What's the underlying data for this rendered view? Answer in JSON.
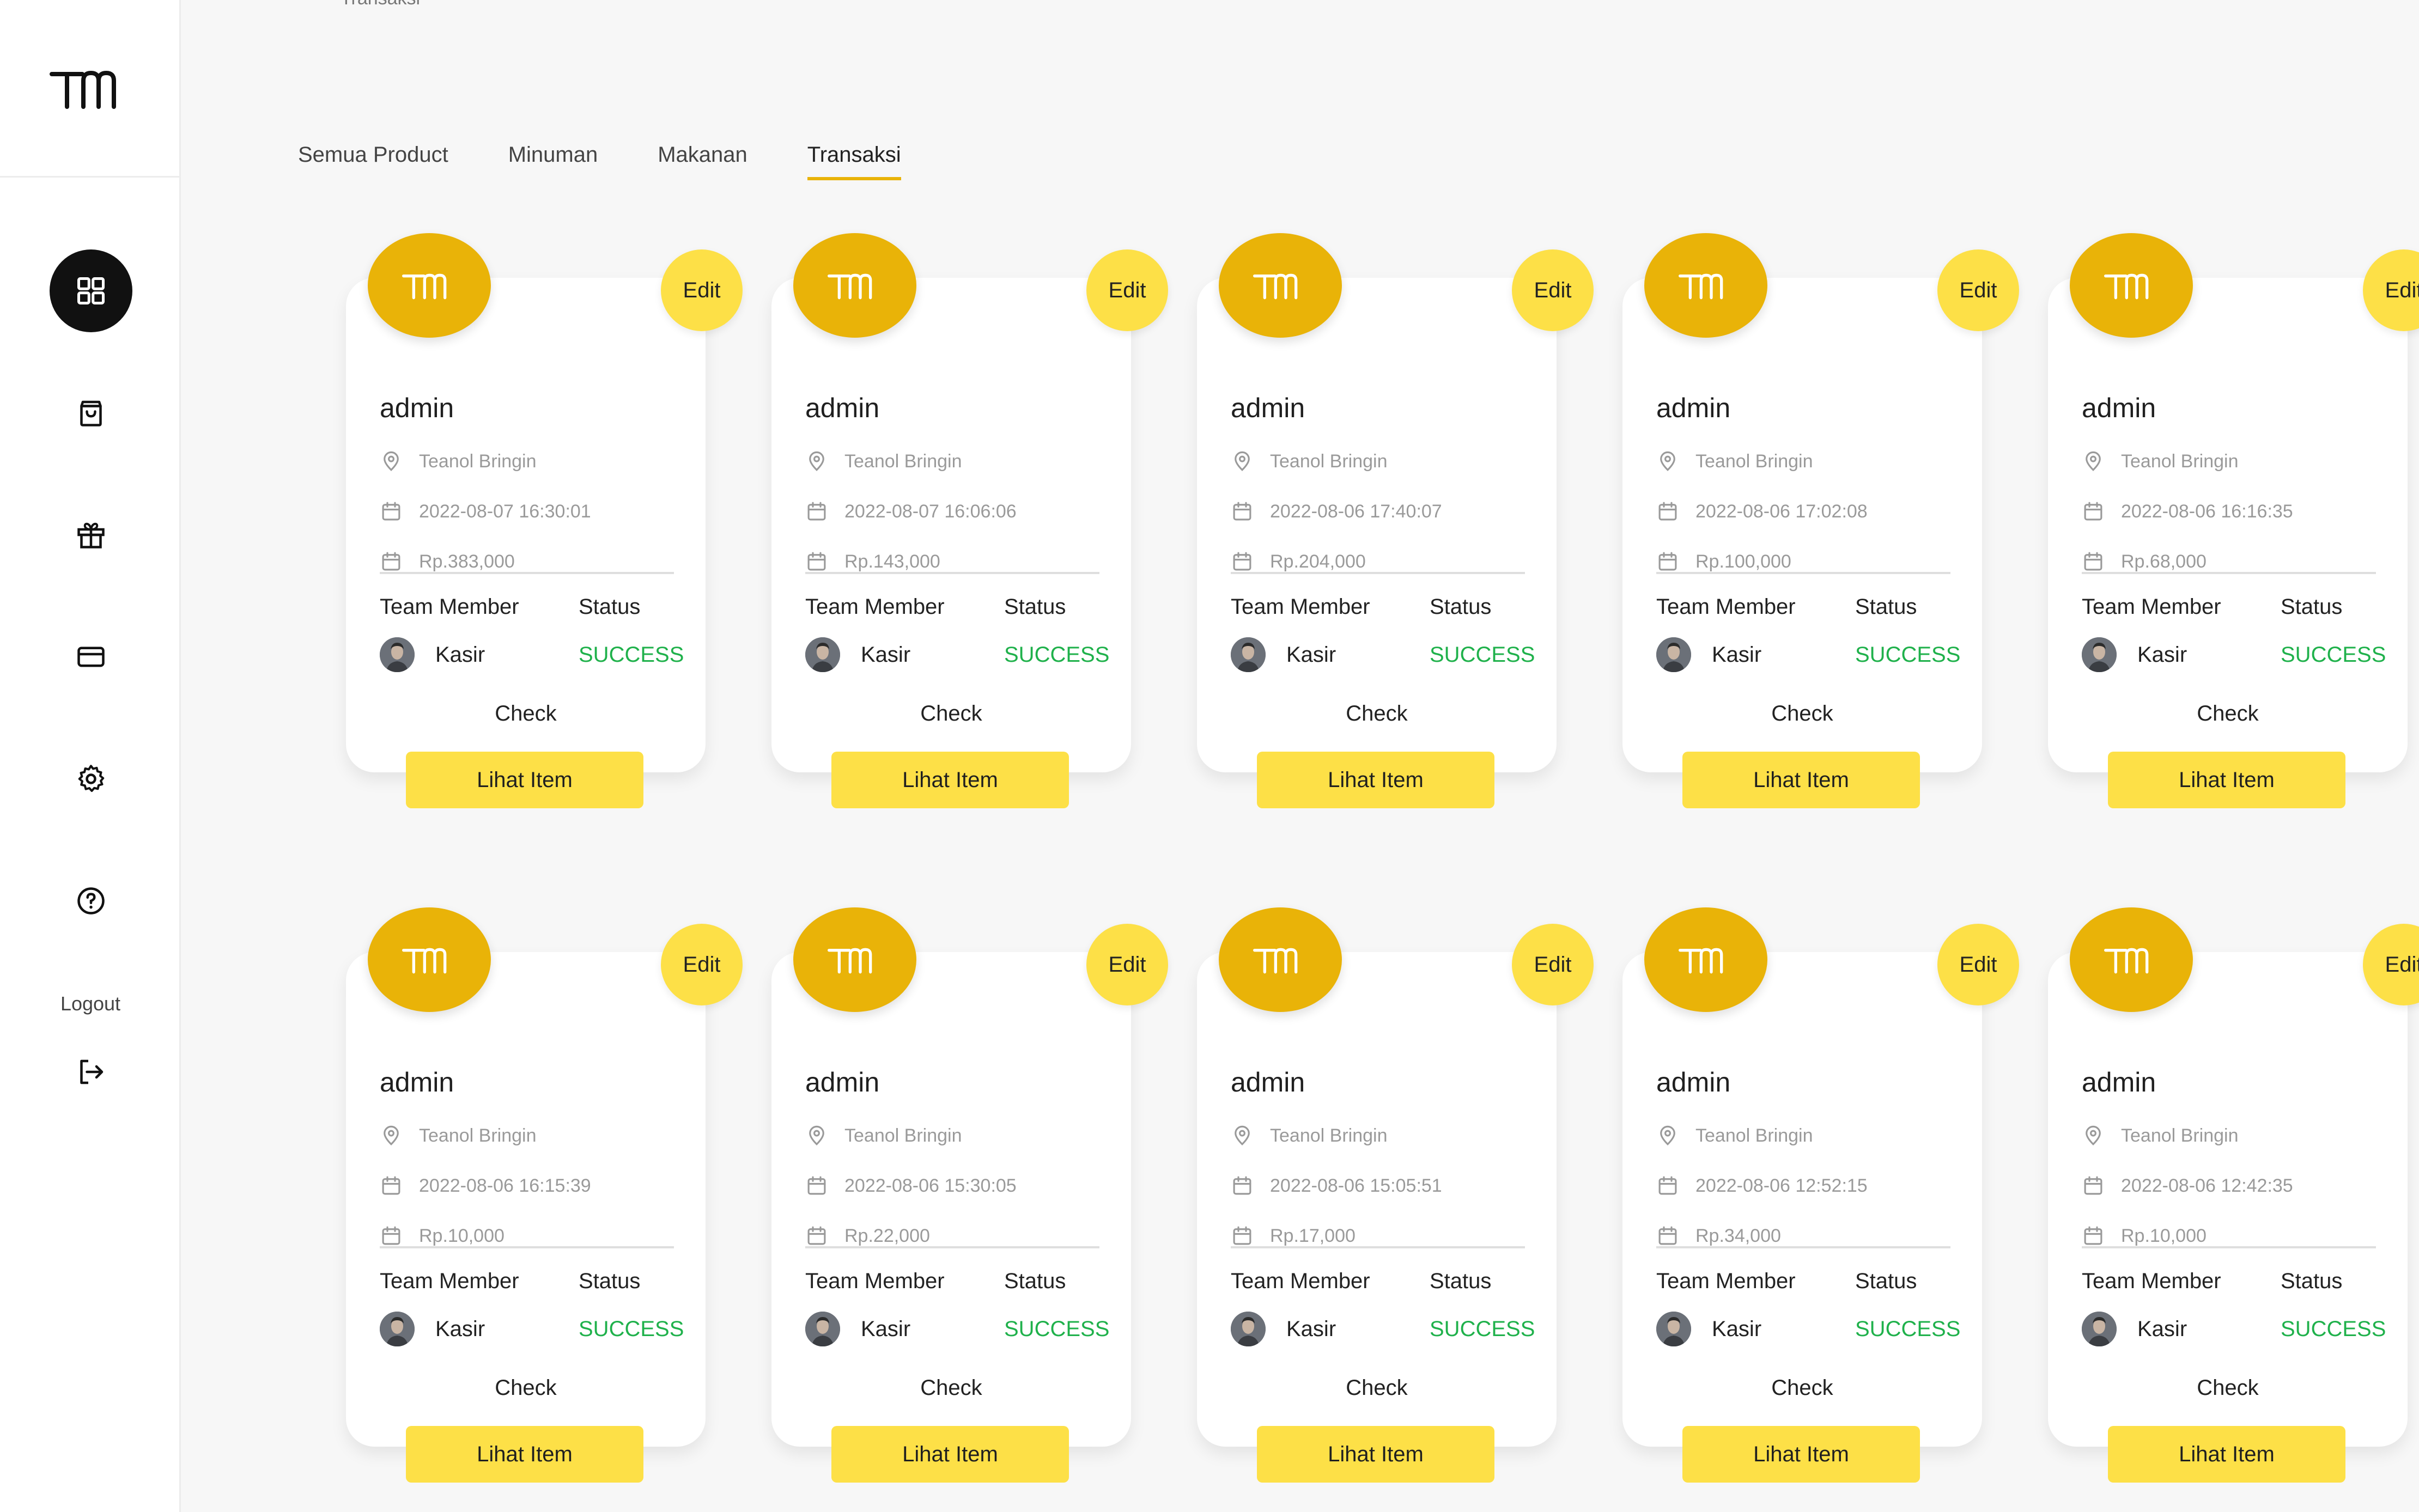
{
  "app": {
    "logo_text": "TM",
    "breadcrumb": "Transaksi",
    "sidebar": {
      "icons": [
        "dashboard-icon",
        "shopping-bag-icon",
        "gift-icon",
        "credit-card-icon",
        "settings-icon",
        "help-icon"
      ],
      "logout_label": "Logout"
    },
    "tabs": [
      "Semua Product",
      "Minuman",
      "Makanan",
      "Transaksi"
    ],
    "active_tab": "Transaksi",
    "accent_color": "#e9b308",
    "button_color": "#fde047",
    "success_color": "#1fb14b"
  },
  "card_labels": {
    "edit": "Edit",
    "team_member": "Team Member",
    "status": "Status",
    "check": "Check",
    "lihat_item": "Lihat Item"
  },
  "cards": [
    {
      "user": "admin",
      "location": "Teanol Bringin",
      "datetime": "2022-08-07 16:30:01",
      "total": "Rp.383,000",
      "member": "Kasir",
      "status": "SUCCESS"
    },
    {
      "user": "admin",
      "location": "Teanol Bringin",
      "datetime": "2022-08-07 16:06:06",
      "total": "Rp.143,000",
      "member": "Kasir",
      "status": "SUCCESS"
    },
    {
      "user": "admin",
      "location": "Teanol Bringin",
      "datetime": "2022-08-06 17:40:07",
      "total": "Rp.204,000",
      "member": "Kasir",
      "status": "SUCCESS"
    },
    {
      "user": "admin",
      "location": "Teanol Bringin",
      "datetime": "2022-08-06 17:02:08",
      "total": "Rp.100,000",
      "member": "Kasir",
      "status": "SUCCESS"
    },
    {
      "user": "admin",
      "location": "Teanol Bringin",
      "datetime": "2022-08-06 16:16:35",
      "total": "Rp.68,000",
      "member": "Kasir",
      "status": "SUCCESS"
    },
    {
      "user": "admin",
      "location": "Teanol Bringin",
      "datetime": "2022-08-06 16:15:39",
      "total": "Rp.10,000",
      "member": "Kasir",
      "status": "SUCCESS"
    },
    {
      "user": "admin",
      "location": "Teanol Bringin",
      "datetime": "2022-08-06 15:30:05",
      "total": "Rp.22,000",
      "member": "Kasir",
      "status": "SUCCESS"
    },
    {
      "user": "admin",
      "location": "Teanol Bringin",
      "datetime": "2022-08-06 15:05:51",
      "total": "Rp.17,000",
      "member": "Kasir",
      "status": "SUCCESS"
    },
    {
      "user": "admin",
      "location": "Teanol Bringin",
      "datetime": "2022-08-06 12:52:15",
      "total": "Rp.34,000",
      "member": "Kasir",
      "status": "SUCCESS"
    },
    {
      "user": "admin",
      "location": "Teanol Bringin",
      "datetime": "2022-08-06 12:42:35",
      "total": "Rp.10,000",
      "member": "Kasir",
      "status": "SUCCESS"
    }
  ]
}
